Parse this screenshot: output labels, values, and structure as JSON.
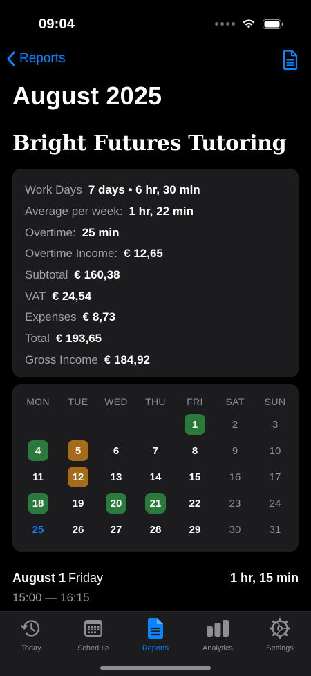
{
  "status_bar": {
    "time": "09:04"
  },
  "nav": {
    "back_label": "Reports",
    "document_icon": "document-icon"
  },
  "page_title": "August 2025",
  "client_name": "Bright Futures Tutoring",
  "summary": [
    {
      "label": "Work Days",
      "value": "7 days • 6 hr, 30 min"
    },
    {
      "label": "Average per week:",
      "value": "1 hr, 22 min"
    },
    {
      "label": "Overtime:",
      "value": "25 min"
    },
    {
      "label": "Overtime Income:",
      "value": "€ 12,65"
    },
    {
      "label": "Subtotal",
      "value": "€ 160,38"
    },
    {
      "label": "VAT",
      "value": "€ 24,54"
    },
    {
      "label": "Expenses",
      "value": "€ 8,73"
    },
    {
      "label": "Total",
      "value": "€ 193,65"
    },
    {
      "label": "Gross Income",
      "value": "€ 184,92"
    }
  ],
  "calendar": {
    "weekdays": [
      "MON",
      "TUE",
      "WED",
      "THU",
      "FRI",
      "SAT",
      "SUN"
    ],
    "first_day_column": 4,
    "days_in_month": 31,
    "today": 25,
    "highlight_colors": {
      "green": "#2a7a3b",
      "amber": "#a56b1c"
    },
    "highlights": {
      "1": "green",
      "4": "green",
      "5": "amber",
      "12": "amber",
      "18": "green",
      "20": "green",
      "21": "green"
    }
  },
  "entry": {
    "date": "August 1",
    "day_name": "Friday",
    "duration": "1 hr, 15 min",
    "time_range": "15:00 — 16:15"
  },
  "tabs": [
    {
      "label": "Today",
      "icon": "clock-history-icon",
      "active": false
    },
    {
      "label": "Schedule",
      "icon": "calendar-grid-icon",
      "active": false
    },
    {
      "label": "Reports",
      "icon": "document-icon",
      "active": true
    },
    {
      "label": "Analytics",
      "icon": "bar-chart-icon",
      "active": false
    },
    {
      "label": "Settings",
      "icon": "gear-icon",
      "active": false
    }
  ],
  "colors": {
    "accent": "#0a84ff",
    "card": "#1c1c1e",
    "background": "#000000"
  }
}
